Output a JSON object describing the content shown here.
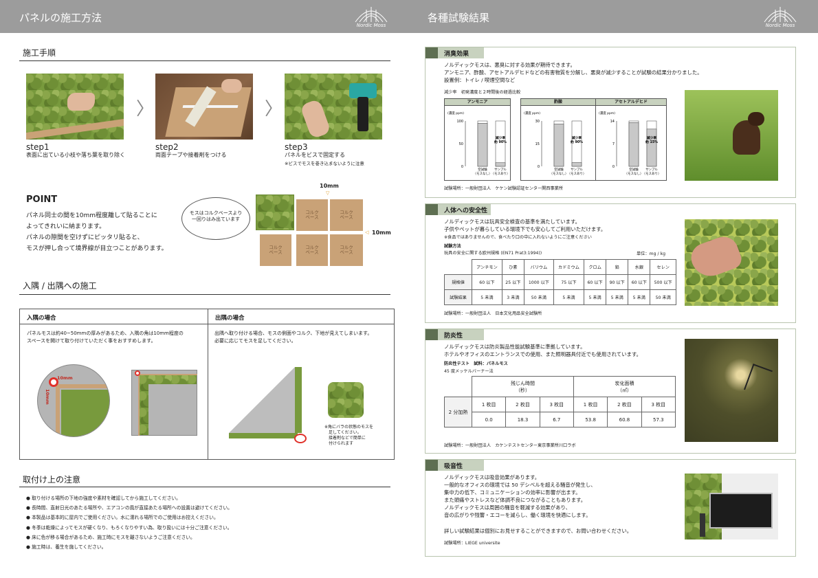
{
  "left": {
    "header_title": "パネルの施工方法",
    "logo": "Nordic Moss",
    "s1_title": "施工手順",
    "steps": [
      {
        "label": "step1",
        "desc": "表面に出ている小枝や落ち葉を取り除く"
      },
      {
        "label": "step2",
        "desc": "両面テープや接着剤をつける"
      },
      {
        "label": "step3",
        "desc": "パネルをビスで固定する",
        "note": "※ビスでモスを巻き込まないように注意"
      }
    ],
    "point_title": "POINT",
    "point_lines": [
      "パネル同士の間を10mm程度離して貼ることに",
      "よってきれいに納まります。",
      "パネルの隙間を空けずにピッタリ貼ると、",
      "モスが押し合って境界線が目立つことがあります。"
    ],
    "bubble": "モスはコルクベースより\n一回りはみ出ています",
    "cork_label": "コルク\nベース",
    "gap_top": "10mm",
    "gap_right": "10mm",
    "s2_title": "入隅 / 出隅への施工",
    "inner_head": "入隅の場合",
    "inner_text": "パネルモスは約40~50mmの厚みがあるため、入隅の角は10mm程度の\nスペースを開けて取り付けていただく事をおすすめします。",
    "outer_head": "出隅の場合",
    "outer_text": "出隅へ取り付ける場合、モスの側面やコルク、下地が見えてしまいます。\n必要に応じてモスを足してください。",
    "circle_lbl_h": "10mm",
    "circle_lbl_v": "10mm",
    "outer_note": "※角にバラの状態のモスを\n　足してください。\n　接着剤などで簡単に\n　付けられます",
    "s3_title": "取付け上の注意",
    "notes": [
      "取り付ける場所の下地の強度や素材を確認してから施工してください。",
      "長時間、直射日光のあたる場所や、エアコンの風が直接あたる場所への設置は避けてください。",
      "本製品は基本的に屋内でご使用ください。水に濡れる場所でのご使用はお控えください。",
      "冬季は乾燥によってモスが硬くなり、もろくなりやすい為、取り扱いには十分ご注意ください。",
      "床に色が移る場合があるため、施工時にモスを離さないようご注意ください。",
      "施工時は、養生を施してください。"
    ]
  },
  "right": {
    "header_title": "各種試験結果",
    "logo": "Nordic Moss",
    "deodor": {
      "tab": "消臭効果",
      "lines": [
        "ノルディックモスは、悪臭に対する効果が期待できます。",
        "アンモニア、酢酸、アセトアルデヒドなどの有害物質を分解し、悪臭が減少することが試験の結果分かりました。",
        "設置例：トイレ / 喫煙空間など"
      ],
      "sub": "減少率　初発濃度と２時間後の経過比較",
      "unit": "(濃度 ppm)",
      "source": "試験場所：一般財団法人　ケケン試験認証センター関西事業所"
    },
    "chart_data": [
      {
        "type": "bar",
        "title": "アンモニア",
        "ylabel": "(濃度 ppm)",
        "ylim": [
          0,
          100
        ],
        "yticks": [
          "100",
          "50",
          "0"
        ],
        "categories": [
          "空試験\n（モスなし）",
          "サンプル\n（モスあり）"
        ],
        "values": [
          95,
          8
        ],
        "annotation": "減少率\n約 90%"
      },
      {
        "type": "bar",
        "title": "酢酸",
        "ylabel": "(濃度 ppm)",
        "ylim": [
          0,
          30
        ],
        "yticks": [
          "30",
          "15",
          "0"
        ],
        "categories": [
          "空試験\n（モスなし）",
          "サンプル\n（モスあり）"
        ],
        "values": [
          28,
          2.5
        ],
        "annotation": "減少率\n約 90%"
      },
      {
        "type": "bar",
        "title": "アセトアルデヒド",
        "ylabel": "(濃度 ppm)",
        "ylim": [
          0,
          14
        ],
        "yticks": [
          "14",
          "7",
          "0"
        ],
        "categories": [
          "空試験\n（モスなし）",
          "サンプル\n（モスあり）"
        ],
        "values": [
          13.5,
          11.5
        ],
        "annotation": "減少率\n約 15%"
      }
    ],
    "safety": {
      "tab": "人体への安全性",
      "lines": [
        "ノルディックモスは玩具安全検査の基準を満たしています。",
        "子供やペットが暮らしている環境下でも安心してご利用いただけます。"
      ],
      "note": "※食品ではありませんので、食べたり口の中に入れないようにご注意ください",
      "method": "試験方法",
      "method_sub": "玩具の安全に関する欧州規格 (EN71 Prat3:1994))",
      "unit": "単位：mg / kg",
      "cols": [
        "アンチモン",
        "ひ素",
        "バリウム",
        "カドミウム",
        "クロム",
        "鉛",
        "水銀",
        "セレン"
      ],
      "row1_label": "規格値",
      "row1": [
        "60 以下",
        "25 以下",
        "1000 以下",
        "75 以下",
        "60 以下",
        "90 以下",
        "60 以下",
        "500 以下"
      ],
      "row2_label": "試験結果",
      "row2": [
        "5 未満",
        "3 未満",
        "50 未満",
        "5 未満",
        "5 未満",
        "5 未満",
        "5 未満",
        "50 未満"
      ],
      "source": "試験場所：一般財団法人　日本文化用品安全試験所"
    },
    "fire": {
      "tab": "防炎性",
      "lines": [
        "ノルディックモスは防炎製品性能試験基準に準拠しています。",
        "ホテルやオフィスのエントランスでの使用、また照明器具付近でも使用されています。"
      ],
      "test": "防炎性テスト　試料：パネルモス",
      "method": "45 度メッケルバーナー法",
      "h1": "残じん時間\n（秒）",
      "h2": "炭化面積\n（㎡）",
      "sub": [
        "1 枚目",
        "2 枚目",
        "3 枚目",
        "1 枚目",
        "2 枚目",
        "3 枚目"
      ],
      "row_label": "2 分加熱",
      "vals": [
        "0.0",
        "18.3",
        "6.7",
        "53.8",
        "60.8",
        "57.3"
      ],
      "source": "試験場所：一般財団法人　カケンテストセンター東京事業所川口ラボ"
    },
    "sound": {
      "tab": "吸音性",
      "lines": [
        "ノルディックモスは吸音効果があります。",
        "一般的なオフィスの環境では 50 デシベルを超える騒音が発生し、",
        "集中力の低下、コミュニケーションの効率に影響が出ます。",
        "また頭痛やストレスなど体調不良につながることもあります。",
        "ノルディックモスは周囲の騒音を軽減する効果があり、",
        "音の広がりや残響・エコーを減らし、働く環境を快適にします。"
      ],
      "contact": "詳しい試験結果は個別にお見せすることができますので、お問い合わせください。",
      "source": "試験場所：LIEGE universite"
    }
  }
}
